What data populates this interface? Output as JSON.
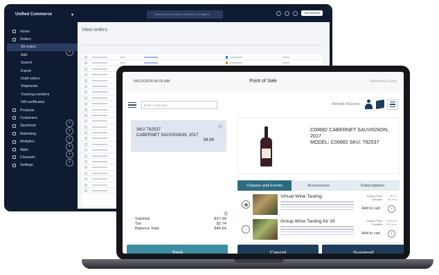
{
  "admin": {
    "brand": "Unified Commerce",
    "search_placeholder": "Search products, orders, customers, or navigate to",
    "store_label": "View storefront",
    "page_title": "View orders",
    "sidebar": [
      {
        "label": "Home",
        "sub": false,
        "chev": false,
        "icon": "home-icon"
      },
      {
        "label": "Orders",
        "sub": false,
        "chev": true,
        "icon": "orders-icon"
      },
      {
        "label": "All orders",
        "sub": true,
        "active": true
      },
      {
        "label": "Add",
        "sub": true
      },
      {
        "label": "Search",
        "sub": true
      },
      {
        "label": "Export",
        "sub": true
      },
      {
        "label": "Draft orders",
        "sub": true
      },
      {
        "label": "Shipments",
        "sub": true
      },
      {
        "label": "Tracking numbers",
        "sub": true
      },
      {
        "label": "Gift certificates",
        "sub": true
      },
      {
        "label": "Products",
        "sub": false,
        "chev": true,
        "icon": "products-icon"
      },
      {
        "label": "Customers",
        "sub": false,
        "chev": true,
        "icon": "customers-icon"
      },
      {
        "label": "Storefront",
        "sub": false,
        "chev": true,
        "icon": "storefront-icon"
      },
      {
        "label": "Marketing",
        "sub": false,
        "chev": true,
        "icon": "marketing-icon"
      },
      {
        "label": "Analytics",
        "sub": false,
        "chev": true,
        "icon": "analytics-icon"
      },
      {
        "label": "Apps",
        "sub": false,
        "chev": true,
        "icon": "apps-icon"
      },
      {
        "label": "Channels",
        "sub": false,
        "chev": false,
        "icon": "channels-icon"
      },
      {
        "label": "Settings",
        "sub": false,
        "chev": false,
        "icon": "settings-icon"
      }
    ],
    "status_colors": [
      "#3a6fd8",
      "#f08a24",
      "#3a6fd8",
      "#3a6fd8",
      "#3a6fd8",
      "#3a6fd8",
      "#3a6fd8",
      "#3a6fd8",
      "#3a6fd8",
      "#3a6fd8",
      "#3a6fd8",
      "#3a6fd8",
      "#3a6fd8",
      "#3a6fd8",
      "#3a6fd8",
      "#3a6fd8",
      "#3a6fd8",
      "#3a6fd8",
      "#3a6fd8",
      "#3a6fd8",
      "#3a6fd8",
      "#3a6fd8",
      "#3a6fd8",
      "#3a6fd8"
    ]
  },
  "pos": {
    "datetime": "04/12/2024 06:00 AM",
    "title": "Point of Sale",
    "user": "Samantha Ryan",
    "search_placeholder": "Enter / Scan item",
    "customer": "Michelle McEnroe",
    "cart_item": {
      "sku": "SKU 792537",
      "name": "CABERNET SAUVIGNON, 2017",
      "price": "34.99"
    },
    "totals": [
      {
        "label": "Subtotal",
        "value": "$37.90"
      },
      {
        "label": "Tax",
        "value": "$2.74"
      },
      {
        "label": "Balance Total",
        "value": "$40.64"
      }
    ],
    "product_title_1": "C00682 CABERNET SAUVIGNON, 2017",
    "product_title_2": "MODEL: C00682 SKU: 792537",
    "tabs": [
      "Classes and Events",
      "Accessories",
      "Subscriptions"
    ],
    "events": [
      {
        "title": "Virtual Wine Tasting",
        "price_label": "Today's Price:",
        "price": "$0.00",
        "duration_label": "Duration:",
        "duration": "60 mins",
        "add": "Add to cart",
        "selected": true
      },
      {
        "title": "Group Wine Tasting for 20",
        "price_label": "Today's Price:",
        "price": "$150.00",
        "duration_label": "Duration:",
        "duration": "120 mins",
        "add": "Add to cart",
        "selected": false
      }
    ],
    "buttons": {
      "total": "Total",
      "cancel": "Cancel",
      "suspend": "Suspend"
    },
    "accent": "#3d8ea3",
    "navy": "#1e3d5a"
  }
}
